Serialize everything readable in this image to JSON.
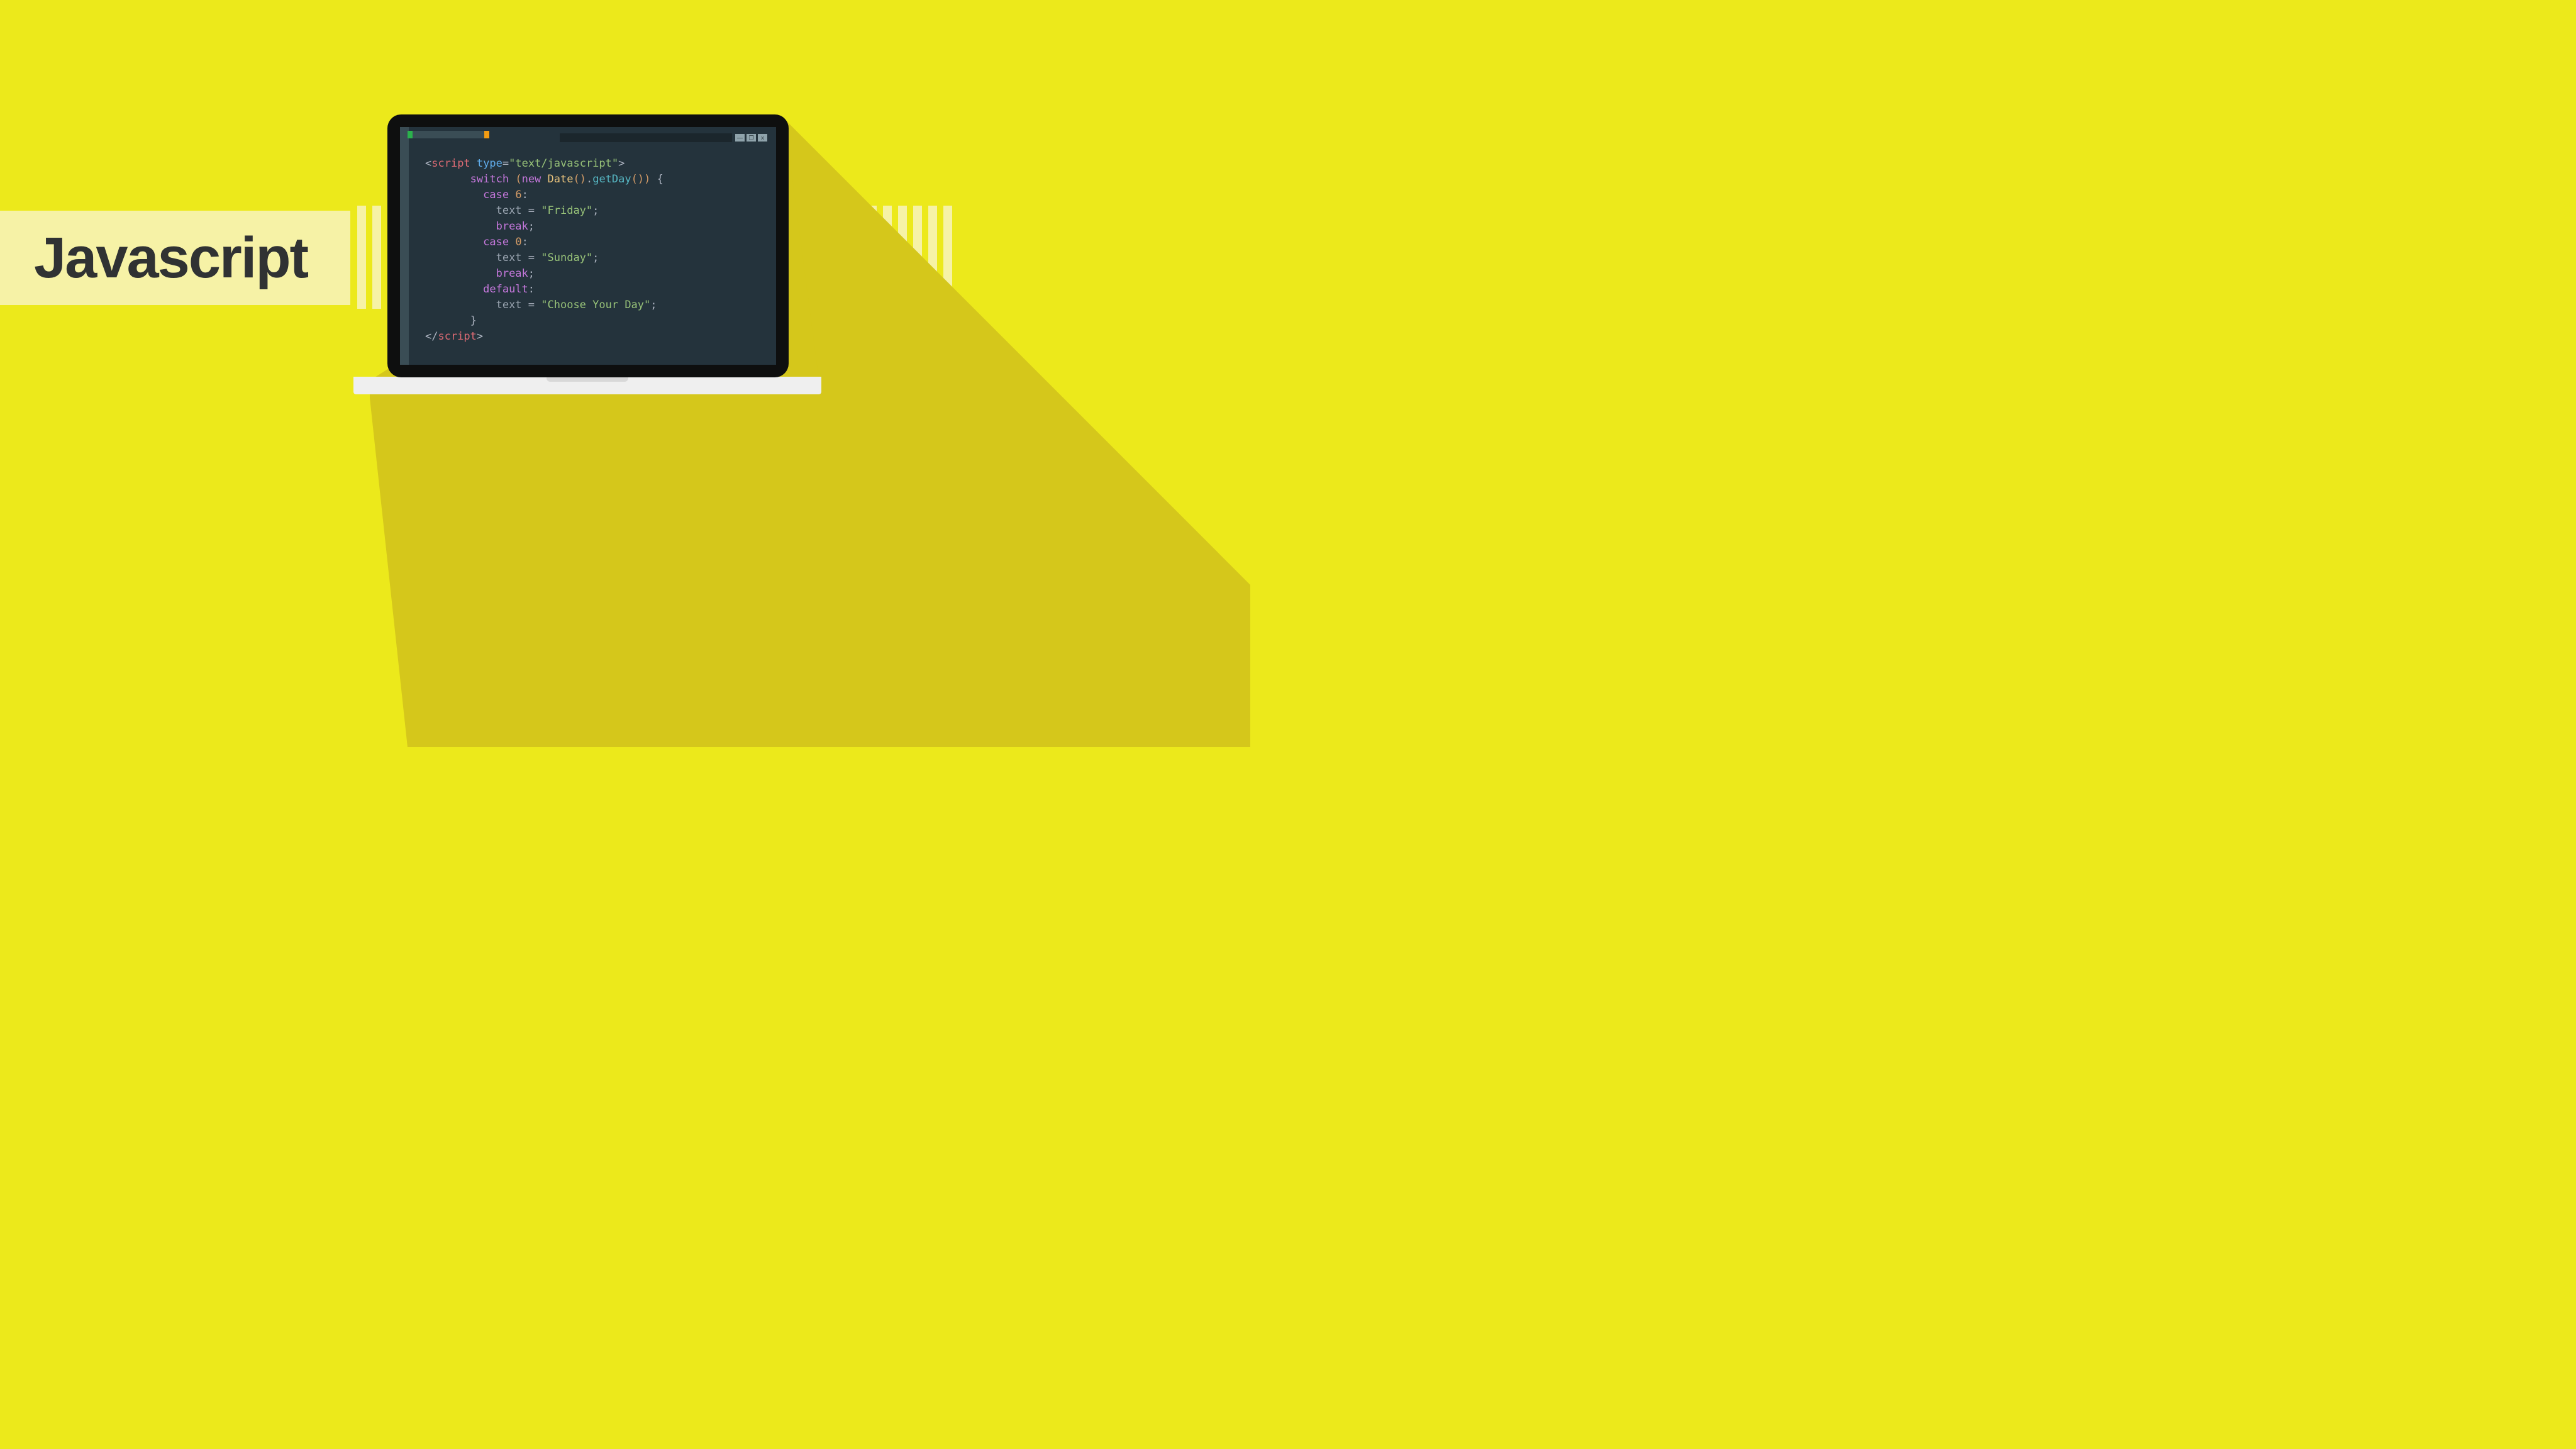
{
  "title": "Javascript",
  "window": {
    "min": "—",
    "max": "❐",
    "close": "x"
  },
  "code": {
    "l1": {
      "open": "<",
      "tag": "script",
      "sp": " ",
      "attr": "type",
      "eq": "=",
      "val": "\"text/javascript\"",
      "close": ">"
    },
    "l2": {
      "kw": "switch",
      "sp": " ",
      "po": "(",
      "new": "new",
      "cls": " Date",
      "call1": "()",
      "dot": ".",
      "fn": "getDay",
      "call2": "()",
      "pc": ")",
      "brace": " {"
    },
    "l3": {
      "kw": "case",
      "sp": " ",
      "num": "6",
      "colon": ":"
    },
    "l4": {
      "id": "text",
      "eq": " = ",
      "str": "\"Friday\"",
      "semi": ";"
    },
    "l5": {
      "kw": "break",
      "semi": ";"
    },
    "l6": {
      "kw": "case",
      "sp": " ",
      "num": "0",
      "colon": ":"
    },
    "l7": {
      "id": "text",
      "eq": " = ",
      "str": "\"Sunday\"",
      "semi": ";"
    },
    "l8": {
      "kw": "break",
      "semi": ";"
    },
    "l9": {
      "kw": "default",
      "colon": ":"
    },
    "l10": {
      "id": "text",
      "eq": " = ",
      "str": "\"Choose Your Day\"",
      "semi": ";"
    },
    "l11": {
      "brace": "}"
    },
    "l12": {
      "open": "</",
      "tag": "script",
      "close": ">"
    }
  },
  "indent": {
    "i1": "       ",
    "i2": "         ",
    "i3": "           "
  }
}
